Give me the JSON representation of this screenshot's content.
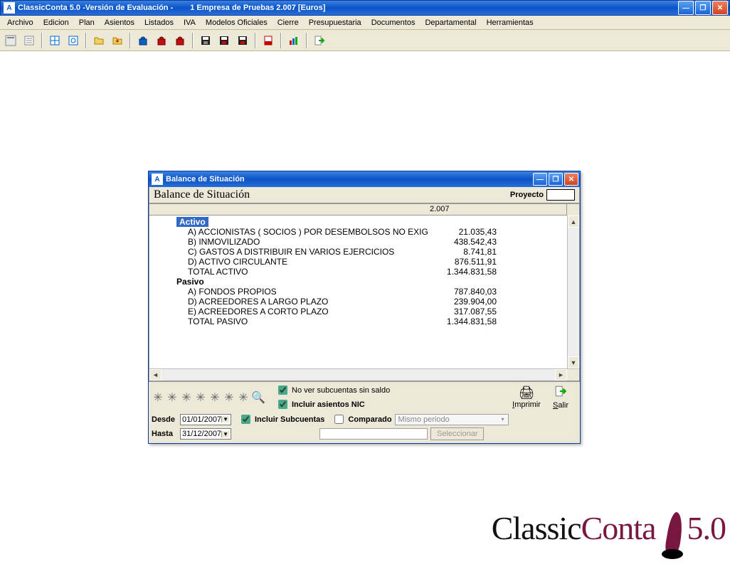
{
  "main_window": {
    "title_left": "ClassicConta 5.0 -Versión de Evaluación -",
    "title_right": "1 Empresa de Pruebas 2.007 [Euros]"
  },
  "menubar": [
    "Archivo",
    "Edicion",
    "Plan",
    "Asientos",
    "Listados",
    "IVA",
    "Modelos Oficiales",
    "Cierre",
    "Presupuestaria",
    "Documentos",
    "Departamental",
    "Herramientas"
  ],
  "dialog": {
    "title": "Balance de Situación",
    "header_title": "Balance de Situación",
    "proyecto_label": "Proyecto",
    "year": "2.007",
    "activo_title": "Activo",
    "pasivo_title": "Pasivo",
    "activo_rows": [
      {
        "label": "A) ACCIONISTAS ( SOCIOS ) POR DESEMBOLSOS NO EXIGIDO",
        "value": "21.035,43"
      },
      {
        "label": "B) INMOVILIZADO",
        "value": "438.542,43"
      },
      {
        "label": "C) GASTOS A DISTRIBUIR EN VARIOS EJERCICIOS",
        "value": "8.741,81"
      },
      {
        "label": "D) ACTIVO CIRCULANTE",
        "value": "876.511,91"
      },
      {
        "label": "TOTAL  ACTIVO",
        "value": "1.344.831,58"
      }
    ],
    "pasivo_rows": [
      {
        "label": "A) FONDOS PROPIOS",
        "value": "787.840,03"
      },
      {
        "label": "D) ACREEDORES A LARGO PLAZO",
        "value": "239.904,00"
      },
      {
        "label": "E) ACREEDORES A CORTO PLAZO",
        "value": "317.087,55"
      },
      {
        "label": "TOTAL  PASIVO",
        "value": "1.344.831,58"
      }
    ],
    "footer": {
      "no_ver_subcuentas": "No ver subcuentas sin saldo",
      "incluir_nic": "Incluir asientos NIC",
      "desde_label": "Desde",
      "desde_value": "01/01/2007",
      "hasta_label": "Hasta",
      "hasta_value": "31/12/2007",
      "incluir_sub_label": "Incluir Subcuentas",
      "comparado_label": "Comparado",
      "comparado_combo": "Mismo periodo",
      "seleccionar_btn": "Seleccionar",
      "imprimir": "Imprimir",
      "salir": "Salir"
    }
  },
  "logo": {
    "word1": "Classic",
    "word2": "Conta",
    "version": "5.0"
  }
}
